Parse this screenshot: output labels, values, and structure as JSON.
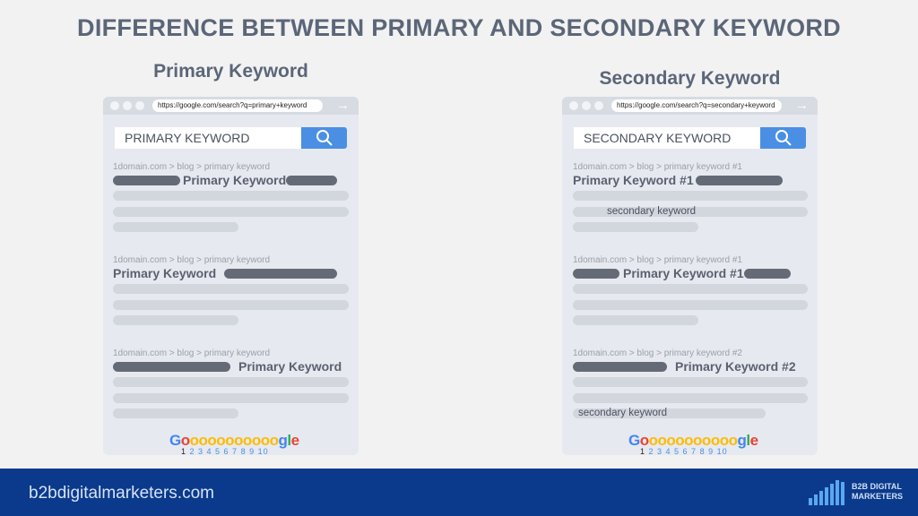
{
  "title": "DIFFERENCE BETWEEN PRIMARY AND SECONDARY KEYWORD",
  "colors": {
    "background": "#f2f2f2",
    "footer": "#0b3a8c",
    "search_button": "#4a8fe3",
    "dark_bar": "#656b76",
    "light_bar": "#d2d6dd"
  },
  "left": {
    "heading": "Primary Keyword",
    "url": "https://google.com/search?q=primary+keyword",
    "search": "PRIMARY KEYWORD",
    "results": [
      {
        "breadcrumb": "1domain.com > blog > primary keyword",
        "title": "Primary Keyword"
      },
      {
        "breadcrumb": "1domain.com > blog > primary keyword",
        "title": "Primary Keyword"
      },
      {
        "breadcrumb": "1domain.com > blog > primary keyword",
        "title": "Primary Keyword"
      }
    ]
  },
  "right": {
    "heading": "Secondary Keyword",
    "url": "https://google.com/search?q=secondary+keyword",
    "search": "SECONDARY KEYWORD",
    "results": [
      {
        "breadcrumb": "1domain.com > blog > primary keyword #1",
        "title": "Primary Keyword #1",
        "secondary": "secondary keyword"
      },
      {
        "breadcrumb": "1domain.com > blog > primary keyword #1",
        "title": "Primary Keyword #1"
      },
      {
        "breadcrumb": "1domain.com > blog > primary keyword #2",
        "title": "Primary Keyword #2",
        "secondary": "secondary keyword"
      }
    ]
  },
  "pagination": {
    "current": "1",
    "pages": "2 3 4 5 6 7 8 9 10"
  },
  "footer": {
    "site": "b2bdigitalmarketers.com",
    "brand_line1": "B2B DIGITAL",
    "brand_line2": "MARKETERS"
  }
}
